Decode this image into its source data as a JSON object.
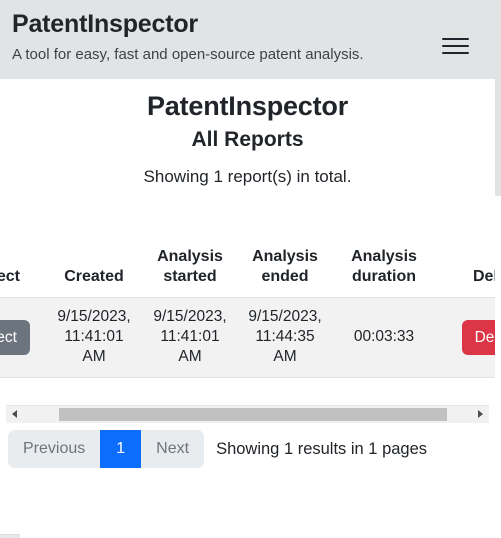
{
  "header": {
    "app_title": "PatentInspector",
    "app_subtitle": "A tool for easy, fast and open-source patent analysis.",
    "menu_icon": "hamburger-menu-icon",
    "background_color": "#e2e3e5"
  },
  "main": {
    "page_title": "PatentInspector",
    "page_subtitle": "All Reports",
    "report_count_text": "Showing 1 report(s) in total."
  },
  "table": {
    "columns": [
      {
        "key": "inspect",
        "label": "pect",
        "full_label": "Inspect",
        "clipped": true
      },
      {
        "key": "created",
        "label": "Created",
        "full_label": "Created",
        "clipped": false
      },
      {
        "key": "started",
        "label": "Analysis started",
        "full_label": "Analysis started",
        "clipped": false
      },
      {
        "key": "ended",
        "label": "Analysis ended",
        "full_label": "Analysis ended",
        "clipped": false
      },
      {
        "key": "duration",
        "label": "Analysis duration",
        "full_label": "Analysis duration",
        "clipped": false
      },
      {
        "key": "delete",
        "label": "Delet",
        "full_label": "Delete",
        "clipped": true
      }
    ],
    "rows": [
      {
        "inspect_button_label": "pect",
        "inspect_button_full_label": "Inspect",
        "created": "9/15/2023, 11:41:01 AM",
        "analysis_started": "9/15/2023, 11:41:01 AM",
        "analysis_ended": "9/15/2023, 11:44:35 AM",
        "analysis_duration": "00:03:33",
        "delete_button_label": "Delet",
        "delete_button_full_label": "Delete"
      }
    ],
    "horizontal_scroll": {
      "left_arrow_icon": "chevron-left-icon",
      "right_arrow_icon": "chevron-right-icon",
      "scrolled": true
    }
  },
  "pagination": {
    "previous_label": "Previous",
    "next_label": "Next",
    "pages": [
      {
        "label": "1",
        "active": true
      }
    ],
    "status_text": "Showing 1 results in 1 pages",
    "active_color": "#0d6efd"
  },
  "colors": {
    "header_bg": "#e2e3e5",
    "inspect_button": "#6c757d",
    "delete_button": "#dc3545",
    "pagination_bg": "#e9ecef",
    "pagination_active": "#0d6efd",
    "row_bg": "#f2f2f3",
    "text": "#212529"
  }
}
